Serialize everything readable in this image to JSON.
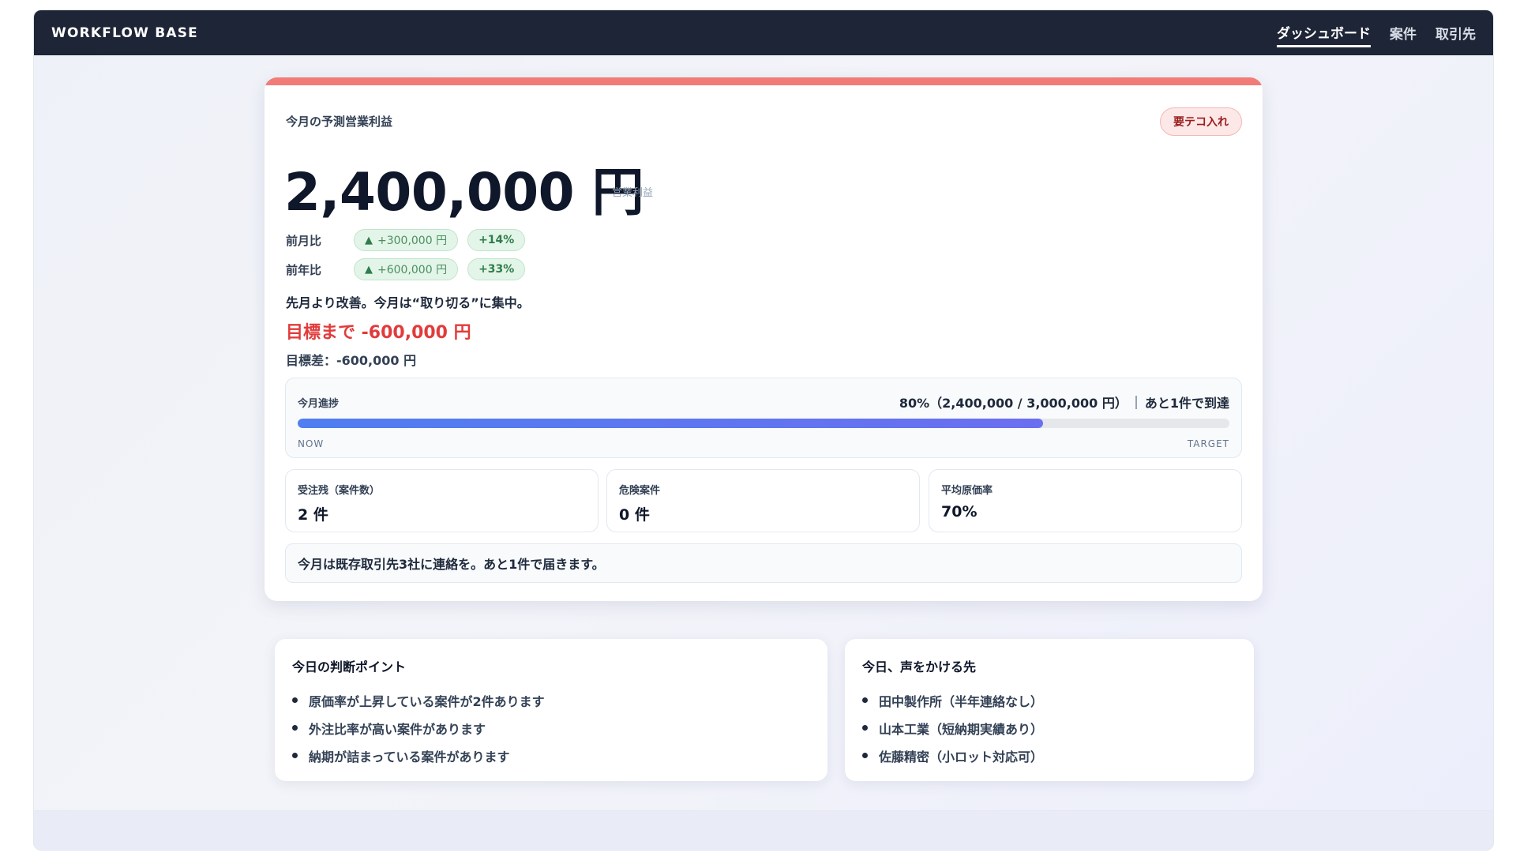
{
  "app": {
    "brand": "WORKFLOW BASE"
  },
  "nav": {
    "items": [
      {
        "label": "ダッシュボード",
        "active": true
      },
      {
        "label": "案件",
        "active": false
      },
      {
        "label": "取引先",
        "active": false
      }
    ]
  },
  "profit_card": {
    "label": "今月の予測営業利益",
    "badge": "要テコ入れ",
    "value": "2,400,000 円",
    "value_caption": "営業利益",
    "comparisons": [
      {
        "label": "前月比",
        "delta": "+300,000 円",
        "percent": "+14%",
        "arrow": "up-triangle-icon"
      },
      {
        "label": "前年比",
        "delta": "+600,000 円",
        "percent": "+33%",
        "arrow": "up-triangle-icon"
      }
    ],
    "comment": "先月より改善。今月は“取り切る”に集中。",
    "gap_headline": "目標まで -600,000 円",
    "gap_detail": "目標差：-600,000 円"
  },
  "progress": {
    "label": "今月進捗",
    "summary": "80%（2,400,000 / 3,000,000 円）",
    "remaining": "あと1件で到達",
    "percent": 80,
    "start_label": "NOW",
    "end_label": "TARGET"
  },
  "stats": [
    {
      "label": "受注残（案件数）",
      "value": "2 件"
    },
    {
      "label": "危険案件",
      "value": "0 件"
    },
    {
      "label": "平均原価率",
      "value": "70%"
    }
  ],
  "advice": "今月は既存取引先3社に連絡を。あと1件で届きます。",
  "decision_points": {
    "title": "今日の判断ポイント",
    "items": [
      "原価率が上昇している案件が2件あります",
      "外注比率が高い案件があります",
      "納期が詰まっている案件があります"
    ]
  },
  "contacts": {
    "title": "今日、声をかける先",
    "items": [
      "田中製作所（半年連絡なし）",
      "山本工業（短納期実績あり）",
      "佐藤精密（小ロット対応可）"
    ]
  },
  "colors": {
    "navbar": "#1e2536",
    "alert_accent": "#f17c77",
    "negative_text": "#e23b3b",
    "positive_pill": "#e3f5e8",
    "progress_start": "#4f7ef0",
    "progress_end": "#6b6ff0"
  }
}
